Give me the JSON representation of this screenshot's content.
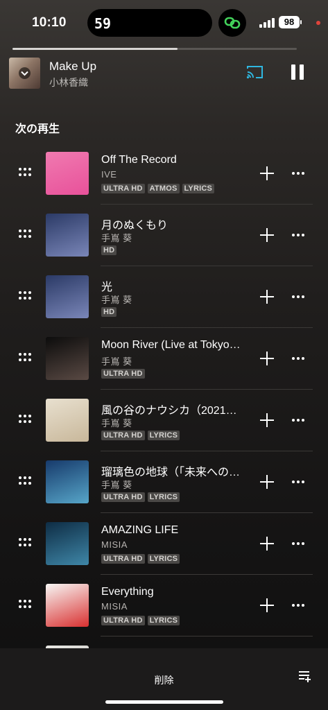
{
  "status_bar": {
    "time": "10:10",
    "island_number": "59",
    "battery": "98"
  },
  "progress": {
    "fraction": 0.58
  },
  "now_playing": {
    "title": "Make Up",
    "artist": "小林香織"
  },
  "section": {
    "title": "次の再生"
  },
  "queue": [
    {
      "title": "Off The Record",
      "artist": "IVE",
      "badges": [
        "ULTRA HD",
        "ATMOS",
        "LYRICS"
      ],
      "art_colors": [
        "#f07ab0",
        "#e8519a"
      ]
    },
    {
      "title": "月のぬくもり",
      "artist": "手嶌 葵",
      "badges": [
        "HD"
      ],
      "art_colors": [
        "#2b3a66",
        "#7a86b8"
      ]
    },
    {
      "title": "光",
      "artist": "手嶌 葵",
      "badges": [
        "HD"
      ],
      "art_colors": [
        "#2b3a66",
        "#7a86b8"
      ]
    },
    {
      "title": "Moon River (Live at Tokyo…",
      "artist": "手嶌 葵",
      "badges": [
        "ULTRA HD"
      ],
      "art_colors": [
        "#0c0c0c",
        "#5a4a44"
      ]
    },
    {
      "title": "風の谷のナウシカ（2021…",
      "artist": "手嶌 葵",
      "badges": [
        "ULTRA HD",
        "LYRICS"
      ],
      "art_colors": [
        "#e8e0cf",
        "#c8b79a"
      ]
    },
    {
      "title": "瑠璃色の地球（「未来への…",
      "artist": "手嶌 葵",
      "badges": [
        "ULTRA HD",
        "LYRICS"
      ],
      "art_colors": [
        "#173a6b",
        "#57a6c9"
      ]
    },
    {
      "title": "AMAZING LIFE",
      "artist": "MISIA",
      "badges": [
        "ULTRA HD",
        "LYRICS"
      ],
      "art_colors": [
        "#0e2c44",
        "#3f87a8"
      ]
    },
    {
      "title": "Everything",
      "artist": "MISIA",
      "badges": [
        "ULTRA HD",
        "LYRICS"
      ],
      "art_colors": [
        "#f7f7f5",
        "#d93030"
      ]
    }
  ],
  "bottom": {
    "delete_label": "削除"
  },
  "icons": [
    "chevron-down-icon",
    "cast-icon",
    "pause-icon",
    "drag-handle-icon",
    "add-icon",
    "more-icon",
    "queue-edit-icon"
  ]
}
